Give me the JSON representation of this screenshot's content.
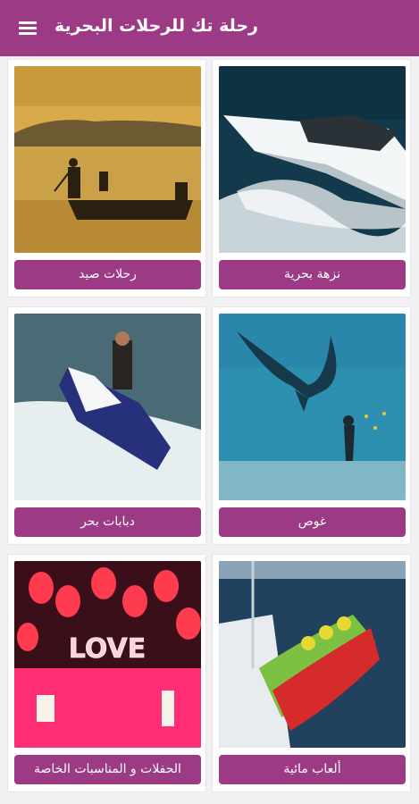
{
  "app": {
    "title": "رحلة تك للرحلات البحرية"
  },
  "header": {
    "menu_icon": "hamburger-menu-icon"
  },
  "colors": {
    "primary": "#9d3a86",
    "background": "#f1f1f3"
  },
  "cards": [
    {
      "label": "نزهة بحرية",
      "image": "yacht-photo"
    },
    {
      "label": "رحلات صيد",
      "image": "fishing-boat-sunset-photo"
    },
    {
      "label": "غوص",
      "image": "diver-manta-ray-photo"
    },
    {
      "label": "دبابات بحر",
      "image": "jet-ski-photo"
    },
    {
      "label": "ألعاب مائية",
      "image": "inflatable-tube-photo"
    },
    {
      "label": "الحفلات و المناسبات الخاصة",
      "image": "love-balloons-party-photo"
    }
  ],
  "party_sign": "LOVE"
}
